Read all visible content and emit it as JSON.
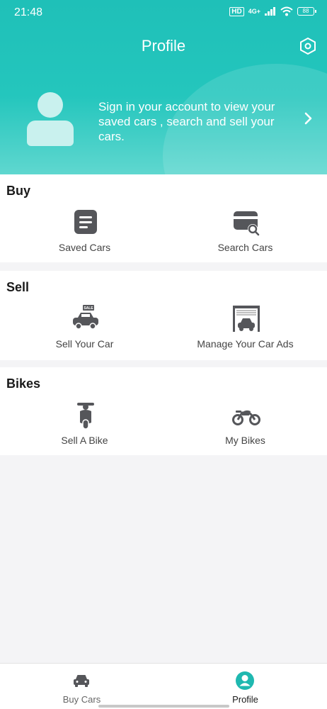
{
  "status_bar": {
    "time": "21:48",
    "hd": "HD",
    "network": "4G+",
    "battery": "88"
  },
  "header": {
    "title": "Profile",
    "signin_message": "Sign in your account to view your saved cars , search and sell your cars.",
    "accent_color": "#24c6bd"
  },
  "sections": {
    "buy": {
      "title": "Buy",
      "items": [
        {
          "label": "Saved Cars",
          "icon": "saved-cars-icon"
        },
        {
          "label": "Search Cars",
          "icon": "search-cars-icon"
        }
      ]
    },
    "sell": {
      "title": "Sell",
      "items": [
        {
          "label": "Sell Your Car",
          "icon": "sale-car-icon"
        },
        {
          "label": "Manage Your Car Ads",
          "icon": "garage-icon"
        }
      ]
    },
    "bikes": {
      "title": "Bikes",
      "items": [
        {
          "label": "Sell A Bike",
          "icon": "scooter-icon"
        },
        {
          "label": "My Bikes",
          "icon": "motorcycle-icon"
        }
      ]
    }
  },
  "bottom_nav": {
    "items": [
      {
        "label": "Buy Cars",
        "icon": "car-icon",
        "active": false
      },
      {
        "label": "Profile",
        "icon": "profile-icon",
        "active": true
      }
    ]
  }
}
